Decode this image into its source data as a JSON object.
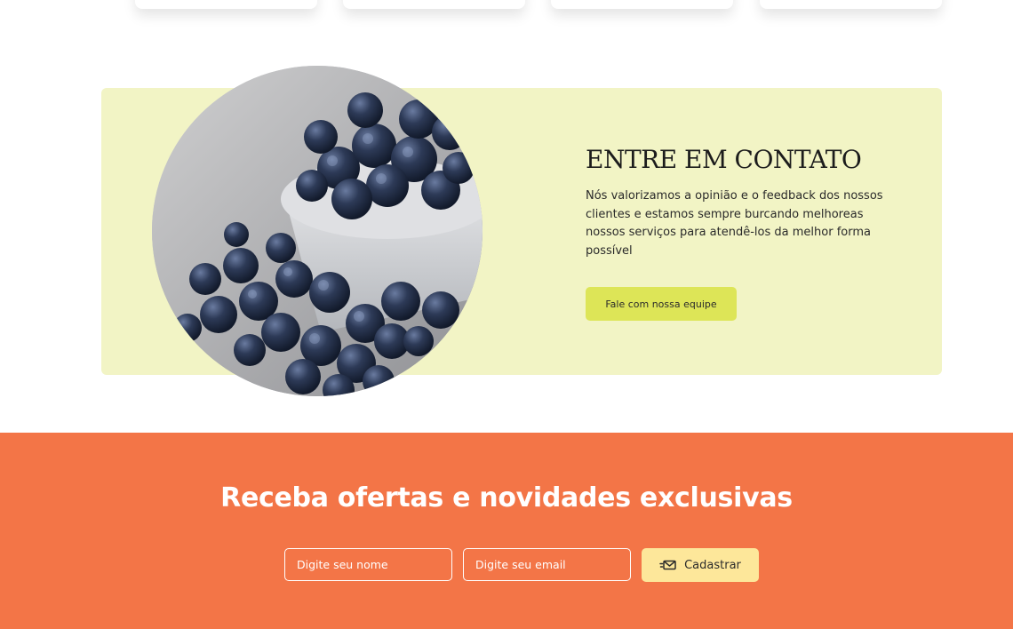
{
  "contact": {
    "title": "ENTRE EM CONTATO",
    "description": "Nós valorizamos a opinião e o feedback dos nossos clientes e estamos sempre burcando melhoreas nossos serviços para atendê-los da melhor forma possível",
    "button_label": "Fale com nossa equipe",
    "image_subject": "blueberries-in-bowl"
  },
  "newsletter": {
    "title": "Receba ofertas e novidades exclusivas",
    "name_placeholder": "Digite seu nome",
    "email_placeholder": "Digite seu email",
    "submit_label": "Cadastrar",
    "submit_icon": "envelope-icon"
  },
  "colors": {
    "contact_background": "#f2f4c5",
    "contact_button": "#dde557",
    "newsletter_background": "#f37547",
    "submit_button": "#fde79a"
  }
}
